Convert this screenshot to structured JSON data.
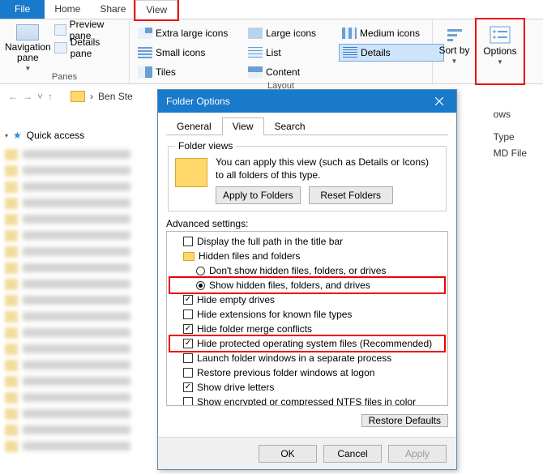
{
  "ribbon": {
    "tabs": {
      "file": "File",
      "home": "Home",
      "share": "Share",
      "view": "View"
    },
    "panes": {
      "navigation": "Navigation pane",
      "preview": "Preview pane",
      "details": "Details pane",
      "group": "Panes"
    },
    "layout": {
      "extra_large": "Extra large icons",
      "large": "Large icons",
      "medium": "Medium icons",
      "small": "Small icons",
      "list": "List",
      "details": "Details",
      "tiles": "Tiles",
      "content": "Content",
      "group": "Layout"
    },
    "sort": "Sort by",
    "options": "Options"
  },
  "address": {
    "path_part": "Ben Ste",
    "right_cut": "ows"
  },
  "sidebar": {
    "quick_access": "Quick access"
  },
  "columns": {
    "type": "Type",
    "kind": "MD File"
  },
  "dialog": {
    "title": "Folder Options",
    "tabs": {
      "general": "General",
      "view": "View",
      "search": "Search"
    },
    "folder_views": {
      "legend": "Folder views",
      "desc": "You can apply this view (such as Details or Icons) to all folders of this type.",
      "apply": "Apply to Folders",
      "reset": "Reset Folders"
    },
    "advanced": {
      "label": "Advanced settings:",
      "items": {
        "full_path": "Display the full path in the title bar",
        "hidden_group": "Hidden files and folders",
        "hidden_dont": "Don't show hidden files, folders, or drives",
        "hidden_show": "Show hidden files, folders, and drives",
        "empty_drives": "Hide empty drives",
        "ext_known": "Hide extensions for known file types",
        "merge": "Hide folder merge conflicts",
        "protected": "Hide protected operating system files (Recommended)",
        "sep_process": "Launch folder windows in a separate process",
        "restore_logon": "Restore previous folder windows at logon",
        "drive_letters": "Show drive letters",
        "ntfs_color": "Show encrypted or compressed NTFS files in color"
      },
      "restore_defaults": "Restore Defaults"
    },
    "buttons": {
      "ok": "OK",
      "cancel": "Cancel",
      "apply": "Apply"
    }
  }
}
